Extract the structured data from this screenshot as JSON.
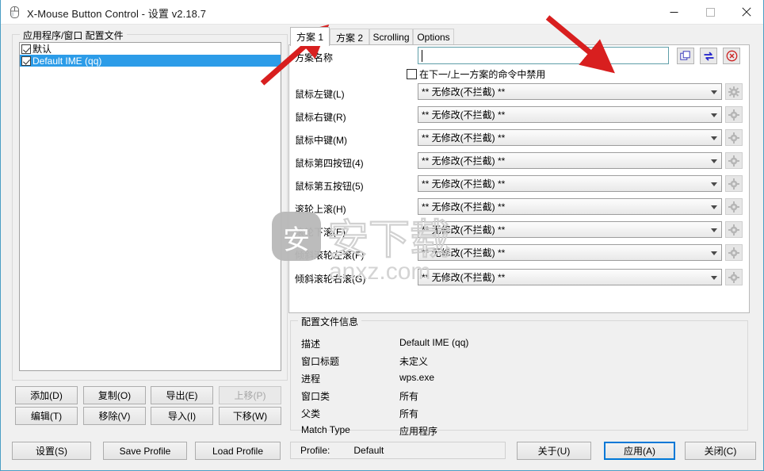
{
  "window": {
    "title": "X-Mouse Button Control - 设置 v2.18.7",
    "icon": "mouse-icon",
    "minimize": "−",
    "maximize": "□",
    "close": "✕",
    "accent_color": "#4a9ec4"
  },
  "left_panel": {
    "group_title": "应用程序/窗口 配置文件",
    "items": [
      {
        "label": "默认",
        "checked": true,
        "selected": false
      },
      {
        "label": "Default IME (qq)",
        "checked": true,
        "selected": true
      }
    ],
    "buttons": [
      {
        "label": "添加(D)",
        "disabled": false
      },
      {
        "label": "复制(O)",
        "disabled": false
      },
      {
        "label": "导出(E)",
        "disabled": false
      },
      {
        "label": "上移(P)",
        "disabled": true
      },
      {
        "label": "编辑(T)",
        "disabled": false
      },
      {
        "label": "移除(V)",
        "disabled": false
      },
      {
        "label": "导入(I)",
        "disabled": false
      },
      {
        "label": "下移(W)",
        "disabled": false
      }
    ]
  },
  "tabs": [
    {
      "label": "方案 1",
      "active": true
    },
    {
      "label": "方案 2",
      "active": false
    },
    {
      "label": "Scrolling",
      "active": false
    },
    {
      "label": "Options",
      "active": false
    }
  ],
  "layer_panel": {
    "name_label": "方案名称",
    "name_value": "",
    "name_placeholder": "",
    "disable_checkbox": {
      "label": "在下一/上一方案的命令中禁用",
      "checked": false
    },
    "icon_buttons": [
      {
        "name": "copy-layer-icon",
        "color": "#3b3bbd"
      },
      {
        "name": "swap-arrows-icon",
        "color": "#2222cc"
      },
      {
        "name": "clear-circle-x-icon",
        "color": "#cc2222"
      }
    ],
    "default_action": "** 无修改(不拦截) **",
    "rows": [
      {
        "label": "鼠标左键(L)",
        "value": "** 无修改(不拦截) **"
      },
      {
        "label": "鼠标右键(R)",
        "value": "** 无修改(不拦截) **"
      },
      {
        "label": "鼠标中键(M)",
        "value": "** 无修改(不拦截) **"
      },
      {
        "label": "鼠标第四按钮(4)",
        "value": "** 无修改(不拦截) **"
      },
      {
        "label": "鼠标第五按钮(5)",
        "value": "** 无修改(不拦截) **"
      },
      {
        "label": "滚轮上滚(H)",
        "value": "** 无修改(不拦截) **"
      },
      {
        "label": "滚轮下滚(E)",
        "value": "** 无修改(不拦截) **"
      },
      {
        "label": "倾斜滚轮左滚(F)",
        "value": "** 无修改(不拦截) **"
      },
      {
        "label": "倾斜滚轮右滚(G)",
        "value": "** 无修改(不拦截) **"
      }
    ]
  },
  "info_panel": {
    "group_title": "配置文件信息",
    "rows": [
      {
        "label": "描述",
        "value": "Default IME (qq)"
      },
      {
        "label": "窗口标题",
        "value": "未定义"
      },
      {
        "label": "进程",
        "value": "wps.exe"
      },
      {
        "label": "窗口类",
        "value": "所有"
      },
      {
        "label": "父类",
        "value": "所有"
      },
      {
        "label": "Match Type",
        "value": "应用程序"
      }
    ]
  },
  "bottom_bar": {
    "settings_label": "设置(S)",
    "save_profile_label": "Save Profile",
    "load_profile_label": "Load Profile",
    "profile_caption": "Profile:",
    "profile_value": "Default",
    "about_label": "关于(U)",
    "apply_label": "应用(A)",
    "close_label": "关闭(C)"
  },
  "watermark": {
    "logo_text": "安",
    "brand_text": "安下载",
    "domain_text": "anxz.com"
  },
  "annotations": {
    "arrow_color": "#d81f1f",
    "arrow_1_target": "方案 1",
    "arrow_2_target": "方案名称 输入框"
  }
}
